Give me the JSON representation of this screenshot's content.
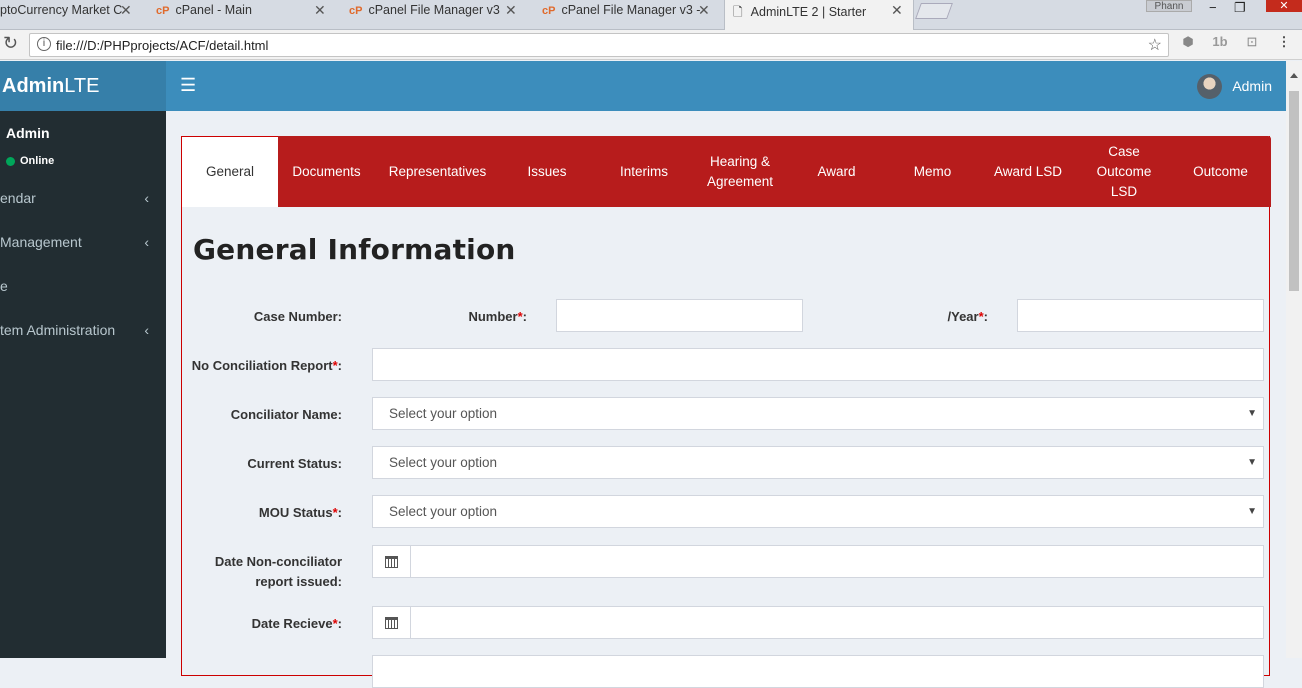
{
  "browser": {
    "tabs": [
      {
        "label": "ptoCurrency Market C",
        "icon": "",
        "active": false
      },
      {
        "label": "cPanel - Main",
        "icon": "cpanel-icon",
        "active": false
      },
      {
        "label": "cPanel File Manager v3",
        "icon": "cpanel-icon",
        "active": false
      },
      {
        "label": "cPanel File Manager v3 -",
        "icon": "cpanel-icon",
        "active": false
      },
      {
        "label": "AdminLTE 2 | Starter",
        "icon": "page-icon",
        "active": true
      }
    ],
    "profile_name": "Phann",
    "url": "file:///D:/PHPprojects/ACF/detail.html"
  },
  "header": {
    "logo_bold": "Admin",
    "logo_rest": "LTE",
    "user_name": "Admin"
  },
  "sidebar": {
    "user_name": "Admin",
    "status": "Online",
    "items": [
      {
        "label": "endar",
        "has_children": true
      },
      {
        "label": "Management",
        "has_children": true
      },
      {
        "label": "e",
        "has_children": false
      },
      {
        "label": "tem Administration",
        "has_children": true
      }
    ]
  },
  "content_tabs": [
    {
      "label": "General",
      "active": true
    },
    {
      "label": "Documents",
      "active": false
    },
    {
      "label": "Representatives",
      "active": false
    },
    {
      "label": "Issues",
      "active": false
    },
    {
      "label": "Interims",
      "active": false
    },
    {
      "label": "Hearing & Agreement",
      "active": false
    },
    {
      "label": "Award",
      "active": false
    },
    {
      "label": "Memo",
      "active": false
    },
    {
      "label": "Award LSD",
      "active": false
    },
    {
      "label": "Case Outcome LSD",
      "active": false
    },
    {
      "label": "Outcome",
      "active": false
    }
  ],
  "form": {
    "title": "General Information",
    "case_number_label": "Case Number:",
    "number_label": "Number",
    "year_label": "/Year",
    "required_mark": "*",
    "no_conciliation_label": "No Conciliation Report",
    "conciliator_label": "Conciliator Name:",
    "current_status_label": "Current Status:",
    "mou_status_label": "MOU Status",
    "date_nonconciliator_label_1": "Date Non-conciliator",
    "date_nonconciliator_label_2": "report issued:",
    "date_receive_label": "Date Recieve",
    "select_placeholder": "Select your option",
    "colon": ":"
  },
  "colors": {
    "header_blue": "#3c8dbc",
    "logo_blue": "#367fa9",
    "sidebar_dark": "#222d32",
    "tab_red": "#b71c1c",
    "online_green": "#00a65a"
  }
}
